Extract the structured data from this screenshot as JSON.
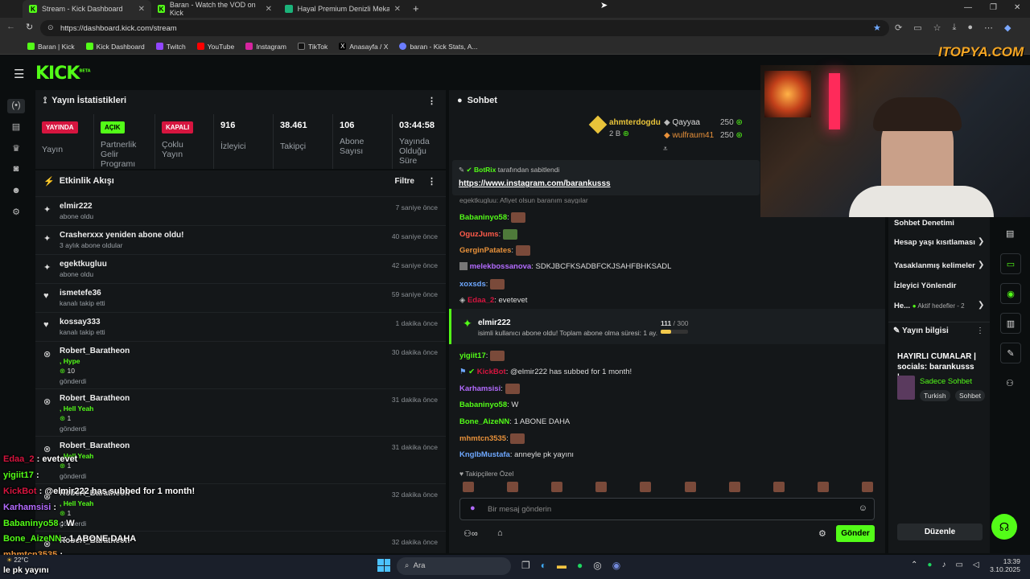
{
  "browser": {
    "tabs": [
      {
        "title": "Stream - Kick Dashboard"
      },
      {
        "title": "Baran - Watch the VOD on Kick"
      },
      {
        "title": "Hayal Premium Denizli Mekan Bil..."
      }
    ],
    "url": "https://dashboard.kick.com/stream",
    "bookmarks": [
      "Baran | Kick",
      "Kick Dashboard",
      "Twitch",
      "YouTube",
      "Instagram",
      "TikTok",
      "Anasayfa / X",
      "baran - Kick Stats, A..."
    ]
  },
  "watermark": "ITOPYA.COM",
  "app": {
    "logo": "KICK",
    "logo_sup": "BETA",
    "stats_panel": {
      "title": "Yayın İstatistikleri",
      "stats": [
        {
          "badge": "YAYINDA",
          "label": "Yayın"
        },
        {
          "badge": "AÇIK",
          "label": "Partnerlik Gelir Programı"
        },
        {
          "badge": "KAPALI",
          "label": "Çoklu Yayın"
        },
        {
          "value": "916",
          "label": "İzleyici"
        },
        {
          "value": "38.461",
          "label": "Takipçi"
        },
        {
          "value": "106",
          "label": "Abone Sayısı"
        },
        {
          "value": "03:44:58",
          "label": "Yayında Olduğu Süre"
        }
      ]
    },
    "activity": {
      "title": "Etkinlik Akışı",
      "filter": "Filtre",
      "items": [
        {
          "user": "elmir222",
          "sub": "abone oldu",
          "time": "7 saniye önce"
        },
        {
          "user": "Crasherxxx yeniden abone oldu!",
          "sub": "3 aylık abone oldular",
          "time": "40 saniye önce"
        },
        {
          "user": "egektkugluu",
          "sub": "abone oldu",
          "time": "42 saniye önce"
        },
        {
          "user": "ismetefe36",
          "sub": "kanalı takip etti",
          "time": "59 saniye önce"
        },
        {
          "user": "kossay333",
          "sub": "kanalı takip etti",
          "time": "1 dakika önce"
        },
        {
          "user": "Robert_Baratheon",
          "kick": ", Hype",
          "amount": "10",
          "sub": "gönderdi",
          "time": "30 dakika önce"
        },
        {
          "user": "Robert_Baratheon",
          "kick": ", Hell Yeah",
          "amount": "1",
          "sub": "gönderdi",
          "time": "31 dakika önce"
        },
        {
          "user": "Robert_Baratheon",
          "kick": ", Hell Yeah",
          "amount": "1",
          "sub": "gönderdi",
          "time": "31 dakika önce"
        },
        {
          "user": "Robert_Baratheon",
          "kick": ", Hell Yeah",
          "amount": "1",
          "sub": "gönderdi",
          "time": "32 dakika önce"
        },
        {
          "user": "Robert_Baratheon",
          "time": "32 dakika önce"
        }
      ]
    },
    "chat": {
      "title": "Sohbet",
      "top_gifters": [
        {
          "name": "ahmterdogdu",
          "amount": "2 B"
        },
        {
          "name": "Qayyaa",
          "amount": "250"
        },
        {
          "name": "wulfraum41",
          "amount": "250"
        }
      ],
      "pinned": {
        "by": "BotRix",
        "by_suffix": "tarafından sabitlendi",
        "link": "https://www.instagram.com/barankusss"
      },
      "partial_line": "egektkugluu: Afiyet olsun baranım saygılar",
      "messages_top": [
        {
          "user": "Babaninyo58",
          "text": ""
        },
        {
          "user": "OguzJums",
          "text": ""
        },
        {
          "user": "GerginPatates",
          "text": ""
        },
        {
          "user": "melekbossanova",
          "text": "SDKJBCFKSADBFCKJSAHFBHKSADL"
        },
        {
          "user": "xoxsds",
          "text": ""
        },
        {
          "user": "Edaa_2",
          "text": "evetevet"
        }
      ],
      "sub_event": {
        "user": "elmir222",
        "text": "isimli kullanıcı abone oldu! Toplam abone olma süresi: 1 ay.",
        "progress": "111",
        "goal": "/ 300"
      },
      "messages_bottom": [
        {
          "user": "yigiit17",
          "text": ""
        },
        {
          "user": "KickBot",
          "text": "@elmir222 has subbed for 1 month!"
        },
        {
          "user": "Karhamsisi",
          "text": ""
        },
        {
          "user": "Babaninyo58",
          "text": "W"
        },
        {
          "user": "Bone_AizeNN",
          "text": "1 ABONE DAHA"
        },
        {
          "user": "mhmtcn3535",
          "text": ""
        },
        {
          "user": "KnglbMustafa",
          "text": "anneyle pk yayını"
        }
      ],
      "followers_only": "Takipçilere Özel",
      "input_placeholder": "Bir mesaj gönderin",
      "send": "Gönder"
    },
    "right_menu": {
      "header": "Sohbet Denetimi",
      "items": [
        "Hesap yaşı kısıtlaması",
        "Yasaklanmış kelimeler",
        "İzleyici Yönlendir",
        "He...",
        "Aktif hedefler - 2"
      ],
      "stream_info_title": "Yayın bilgisi",
      "stream_title": "HAYIRLI CUMALAR | socials: barankusss |...",
      "category": "Sadece Sohbet",
      "tags": [
        "Turkish",
        "Sohbet"
      ],
      "edit": "Düzenle"
    }
  },
  "overlay_chat": [
    {
      "user": "Edaa_2",
      "text": ": evetevet"
    },
    {
      "user": "yigiit17",
      "text": ":"
    },
    {
      "user": "KickBot",
      "text": ": @elmir222 has subbed for 1 month!"
    },
    {
      "user": "Karhamsisi",
      "text": ":"
    },
    {
      "user": "Babaninyo58",
      "text": ": W"
    },
    {
      "user": "Bone_AizeNN",
      "text": ": 1 ABONE DAHA"
    },
    {
      "user": "mhmtcn3535",
      "text": ":"
    },
    {
      "user": "",
      "text": "le pk yayını"
    }
  ],
  "taskbar": {
    "search": "Ara",
    "weather": "22°C",
    "time": "13:39",
    "date": "3.10.2025"
  },
  "colors": {
    "kick_green": "#53fc18",
    "live_red": "#d6153f",
    "panel": "#141719"
  }
}
